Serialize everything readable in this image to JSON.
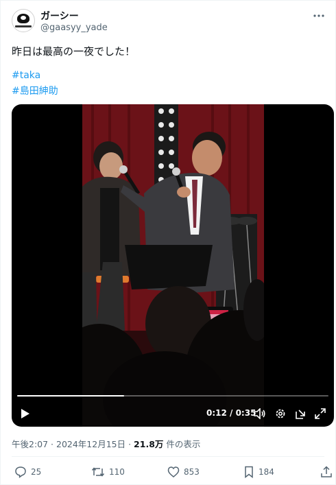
{
  "author": {
    "display_name": "ガーシー",
    "handle": "@gaasyy_yade",
    "avatar_icon": "channel-logo-avatar"
  },
  "tweet": {
    "text": "昨日は最高の一夜でした！",
    "hashtags": [
      "#taka",
      "#島田紳助"
    ]
  },
  "video": {
    "time_readout": "0:12 / 0:35",
    "progress_fraction": 0.343,
    "controls": [
      "play-icon",
      "volume-icon",
      "settings-icon",
      "popout-icon",
      "fullscreen-icon"
    ]
  },
  "meta": {
    "time": "午後2:07",
    "separator": " · ",
    "date": "2024年12月15日",
    "views_count": "21.8万",
    "views_label": " 件の表示"
  },
  "actions": {
    "replies": "25",
    "retweets": "110",
    "likes": "853",
    "bookmarks": "184"
  },
  "colors": {
    "accent": "#1d9bf0",
    "secondary_text": "#536471",
    "stage_curtain": "#6b1218"
  }
}
